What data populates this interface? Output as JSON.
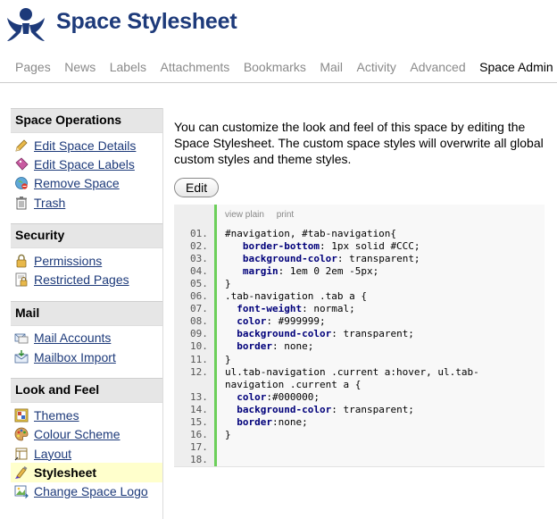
{
  "header": {
    "title": "Space Stylesheet",
    "logo_icon": "confluence-logo-icon"
  },
  "tabs": [
    {
      "label": "Pages",
      "active": false
    },
    {
      "label": "News",
      "active": false
    },
    {
      "label": "Labels",
      "active": false
    },
    {
      "label": "Attachments",
      "active": false
    },
    {
      "label": "Bookmarks",
      "active": false
    },
    {
      "label": "Mail",
      "active": false
    },
    {
      "label": "Activity",
      "active": false
    },
    {
      "label": "Advanced",
      "active": false
    },
    {
      "label": "Space Admin",
      "active": true
    }
  ],
  "sidebar": {
    "sections": [
      {
        "title": "Space Operations",
        "items": [
          {
            "label": "Edit Space Details",
            "icon": "pencil-icon"
          },
          {
            "label": "Edit Space Labels",
            "icon": "label-icon"
          },
          {
            "label": "Remove Space",
            "icon": "remove-globe-icon"
          },
          {
            "label": "Trash",
            "icon": "trash-icon"
          }
        ]
      },
      {
        "title": "Security",
        "items": [
          {
            "label": "Permissions",
            "icon": "lock-icon"
          },
          {
            "label": "Restricted Pages",
            "icon": "locked-page-icon"
          }
        ]
      },
      {
        "title": "Mail",
        "items": [
          {
            "label": "Mail Accounts",
            "icon": "mail-accounts-icon"
          },
          {
            "label": "Mailbox Import",
            "icon": "mailbox-import-icon"
          }
        ]
      },
      {
        "title": "Look and Feel",
        "items": [
          {
            "label": "Themes",
            "icon": "themes-icon"
          },
          {
            "label": "Colour Scheme",
            "icon": "palette-icon"
          },
          {
            "label": "Layout",
            "icon": "layout-icon"
          },
          {
            "label": "Stylesheet",
            "icon": "stylesheet-brush-icon",
            "active": true
          },
          {
            "label": "Change Space Logo",
            "icon": "change-logo-icon"
          }
        ]
      }
    ]
  },
  "main": {
    "description": "You can customize the look and feel of this space by editing the Space Stylesheet. The custom space styles will overwrite all global custom styles and theme styles.",
    "edit_label": "Edit"
  },
  "code": {
    "toolbar": {
      "view_plain": "view plain",
      "print": "print"
    },
    "lines": [
      {
        "num": "01.",
        "text": "#navigation, #tab-navigation{"
      },
      {
        "num": "02.",
        "text": "   border-bottom: 1px solid #CCC;"
      },
      {
        "num": "03.",
        "text": "   background-color: transparent;"
      },
      {
        "num": "04.",
        "text": "   margin: 1em 0 2em -5px;"
      },
      {
        "num": "05.",
        "text": "}"
      },
      {
        "num": "06.",
        "text": ".tab-navigation .tab a {"
      },
      {
        "num": "07.",
        "text": "  font-weight: normal;"
      },
      {
        "num": "08.",
        "text": "  color: #999999;"
      },
      {
        "num": "09.",
        "text": "  background-color: transparent;"
      },
      {
        "num": "10.",
        "text": "  border: none;"
      },
      {
        "num": "11.",
        "text": "}"
      },
      {
        "num": "12.",
        "text": "ul.tab-navigation .current a:hover, ul.tab-"
      },
      {
        "num": "",
        "text": "navigation .current a {"
      },
      {
        "num": "13.",
        "text": "  color:#000000;"
      },
      {
        "num": "14.",
        "text": "  background-color: transparent;"
      },
      {
        "num": "15.",
        "text": "  border:none;"
      },
      {
        "num": "16.",
        "text": "}"
      },
      {
        "num": "17.",
        "text": ""
      },
      {
        "num": "18.",
        "text": ""
      }
    ]
  },
  "colors": {
    "brand": "#1d3a7a",
    "active_bg": "#ffffcc",
    "gutter_accent": "#6ccf5a"
  }
}
